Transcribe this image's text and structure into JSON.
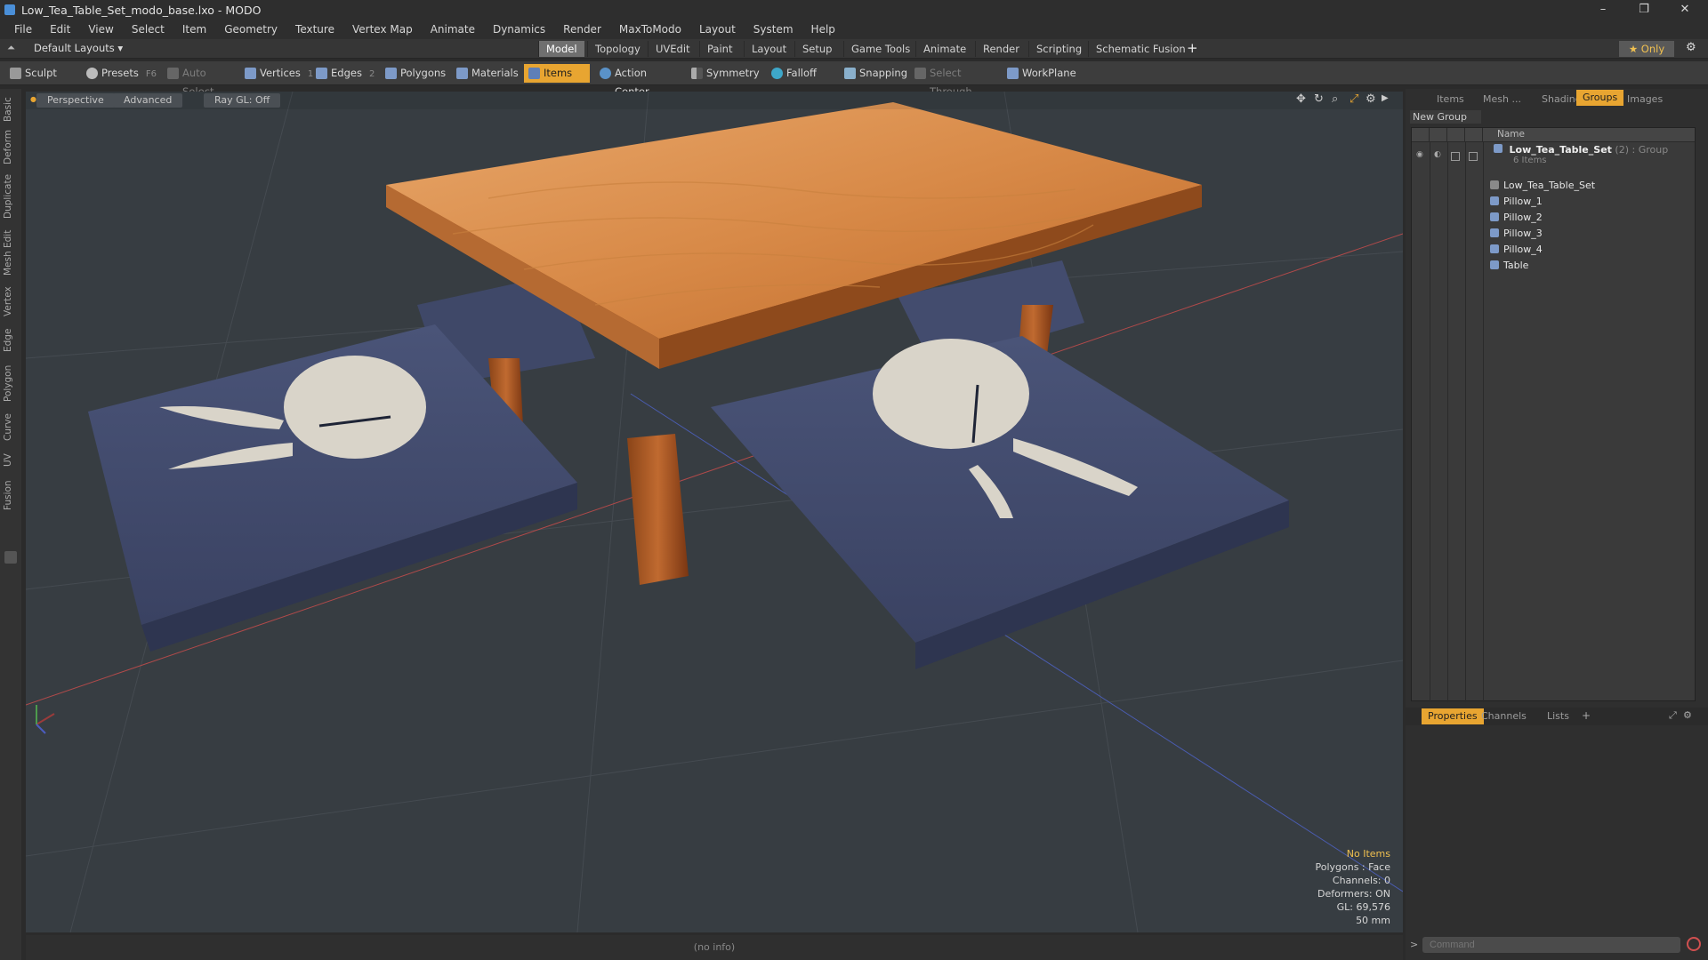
{
  "window": {
    "title": "Low_Tea_Table_Set_modo_base.lxo - MODO",
    "controls": [
      "–",
      "❐",
      "✕"
    ]
  },
  "menu": [
    "File",
    "Edit",
    "View",
    "Select",
    "Item",
    "Geometry",
    "Texture",
    "Vertex Map",
    "Animate",
    "Dynamics",
    "Render",
    "MaxToModo",
    "Layout",
    "System",
    "Help"
  ],
  "layout": {
    "preset": "Default Layouts ▾",
    "tabs": [
      "Model",
      "Topology",
      "UVEdit",
      "Paint",
      "Layout",
      "Setup",
      "Game Tools",
      "Animate",
      "Render",
      "Scripting",
      "Schematic Fusion"
    ],
    "active_tab": "Model",
    "add": "+",
    "only": "★  Only"
  },
  "toolbar": {
    "sculpt": "Sculpt",
    "presets": "Presets",
    "presets_key": "F6",
    "auto_select": "Auto Select",
    "vertices": "Vertices",
    "vertices_count": "1",
    "edges": "Edges",
    "edges_count": "2",
    "polygons": "Polygons",
    "materials": "Materials",
    "items": "Items",
    "action_center": "Action Center",
    "symmetry": "Symmetry",
    "falloff": "Falloff",
    "snapping": "Snapping",
    "select_through": "Select Through",
    "workplane": "WorkPlane"
  },
  "left_tabs": [
    "Basic",
    "Deform",
    "Duplicate",
    "Mesh Edit",
    "Vertex",
    "Edge",
    "Polygon",
    "Curve",
    "UV",
    "Fusion"
  ],
  "viewport": {
    "view": "Perspective",
    "shading": "Advanced",
    "raygl": "Ray GL: Off"
  },
  "info": {
    "no_items": "No Items",
    "polygons": "Polygons : Face",
    "channels": "Channels: 0",
    "deformers": "Deformers: ON",
    "gl": "GL: 69,576",
    "scale": "50 mm"
  },
  "status": "(no info)",
  "right_panel": {
    "tabs": [
      "Items",
      "Mesh ...",
      "Shading",
      "Groups",
      "Images"
    ],
    "active_tab": "Groups",
    "new_group": "New Group",
    "name_header": "Name",
    "group_name": "Low_Tea_Table_Set",
    "group_count": "(2)",
    "group_type": ": Group",
    "group_items": "6 Items",
    "items": [
      "Low_Tea_Table_Set",
      "Pillow_1",
      "Pillow_2",
      "Pillow_3",
      "Pillow_4",
      "Table"
    ]
  },
  "bottom_panel": {
    "tabs": [
      "Properties",
      "Channels",
      "Lists"
    ],
    "active_tab": "Properties",
    "add": "+"
  },
  "command": {
    "placeholder": "Command"
  }
}
